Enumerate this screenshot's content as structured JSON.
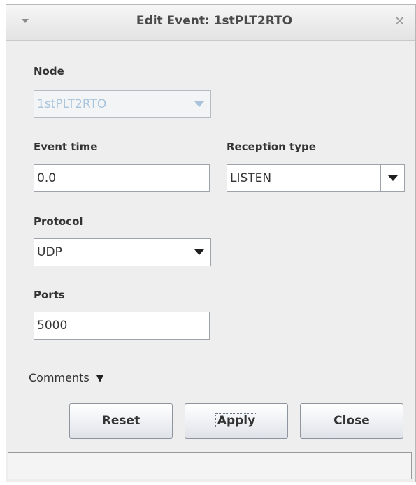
{
  "dialog": {
    "title": "Edit Event: 1stPLT2RTO",
    "menu_icon": "chevron-down-icon",
    "close_icon": "close-icon",
    "close_glyph": "×"
  },
  "node": {
    "label": "Node",
    "value": "1stPLT2RTO",
    "enabled": false
  },
  "event_time": {
    "label": "Event time",
    "value": "0.0"
  },
  "reception_type": {
    "label": "Reception type",
    "value": "LISTEN"
  },
  "protocol": {
    "label": "Protocol",
    "value": "UDP"
  },
  "ports": {
    "label": "Ports",
    "value": "5000"
  },
  "comments": {
    "label": "Comments"
  },
  "buttons": {
    "reset": "Reset",
    "apply": "Apply",
    "close": "Close"
  },
  "status_bar": {
    "text": ""
  }
}
